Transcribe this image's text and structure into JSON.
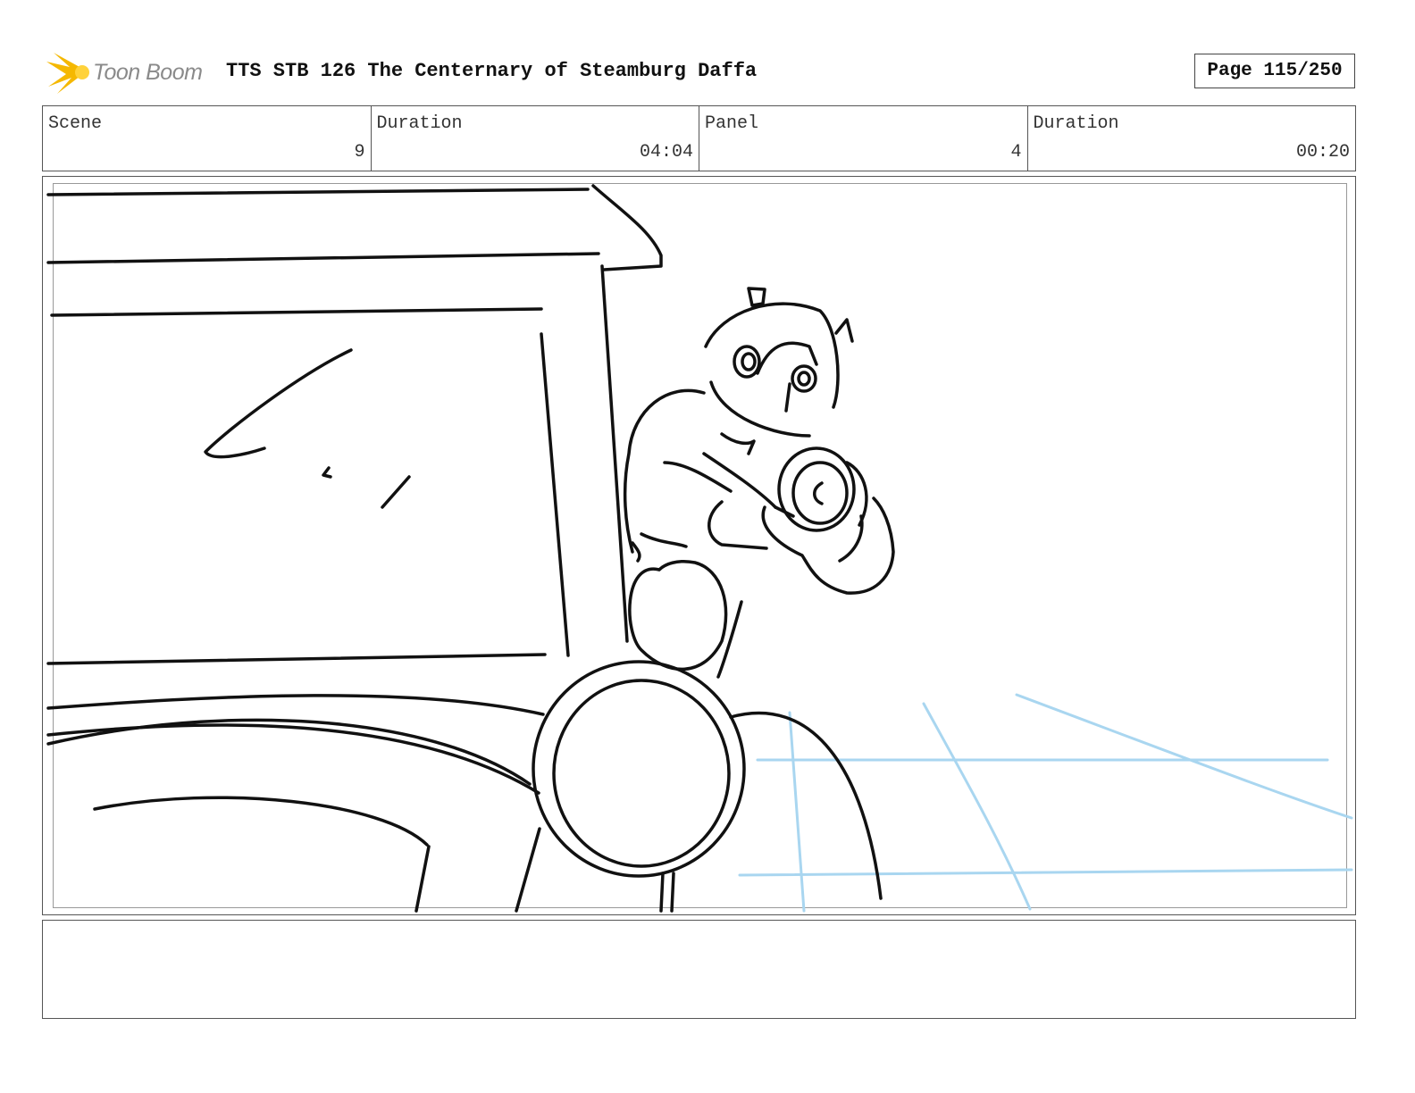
{
  "header": {
    "logo_text": "Toon Boom",
    "title": "TTS STB 126 The Centernary of Steamburg Daffa",
    "page": "Page 115/250"
  },
  "info": {
    "scene_label": "Scene",
    "scene_value": "9",
    "scene_duration_label": "Duration",
    "scene_duration_value": "04:04",
    "panel_label": "Panel",
    "panel_value": "4",
    "panel_duration_label": "Duration",
    "panel_duration_value": "00:20"
  },
  "notes": {
    "text": ""
  },
  "colors": {
    "sketch": "#111111",
    "guide": "#a9d6f0",
    "logo_burst": "#f5b800"
  }
}
